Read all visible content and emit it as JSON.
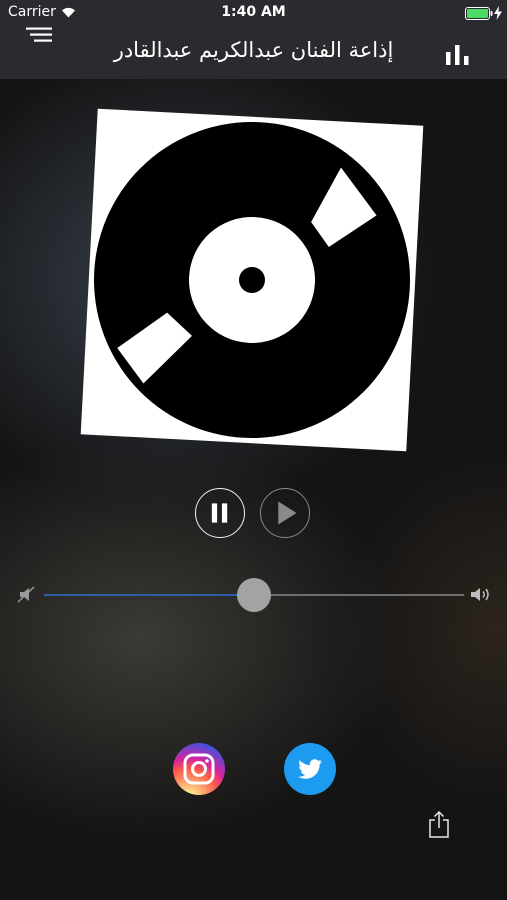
{
  "status_bar": {
    "carrier": "Carrier",
    "time": "1:40 AM",
    "icons": [
      "wifi-icon",
      "battery-icon",
      "charging-icon"
    ],
    "battery_color": "#4cd964"
  },
  "nav": {
    "title": "إذاعة الفنان عبدالكريم عبدالقادر",
    "left_icon": "menu-icon",
    "right_icon": "bar-chart-icon"
  },
  "player": {
    "artwork": "vinyl-record",
    "state": "playing",
    "controls": [
      "pause-icon",
      "play-icon"
    ],
    "volume_level": 0.5
  },
  "social": {
    "buttons": [
      "instagram-icon",
      "twitter-icon"
    ],
    "share_icon": "share-icon"
  },
  "colors": {
    "bar_background": "#2a2b2f",
    "slider_fill": "#2d5ea7",
    "twitter": "#1d9bf0"
  }
}
